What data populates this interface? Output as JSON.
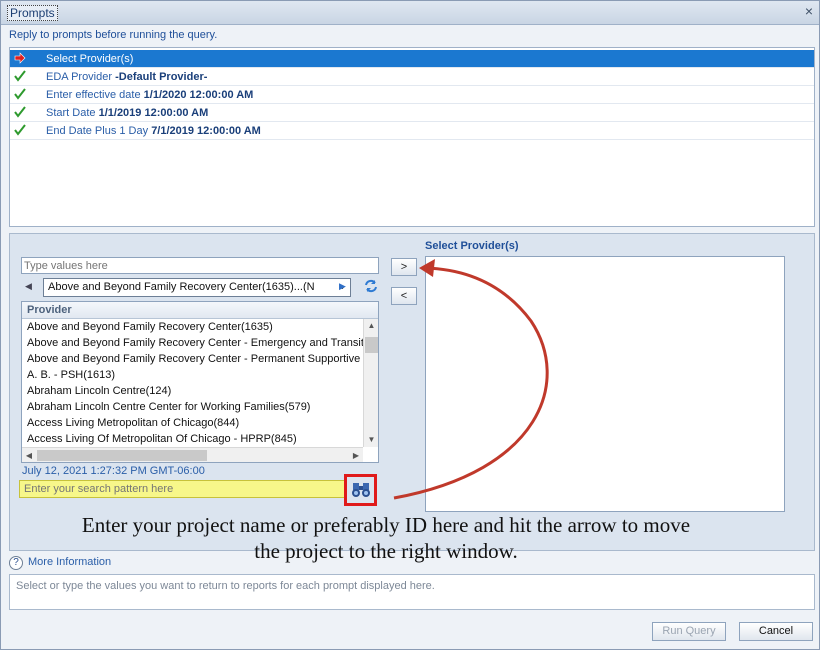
{
  "window": {
    "title": "Prompts",
    "close_glyph": "×"
  },
  "hint": "Reply to prompts before running the query.",
  "prompts": [
    {
      "label": "Select Provider(s)",
      "value": "",
      "status_icon": "red-arrow-icon",
      "selected": true
    },
    {
      "label": "EDA Provider",
      "value": "-Default Provider-",
      "status_icon": "green-check-icon",
      "selected": false
    },
    {
      "label": "Enter effective date",
      "value": "1/1/2020 12:00:00 AM",
      "status_icon": "green-check-icon",
      "selected": false
    },
    {
      "label": "Start Date",
      "value": "1/1/2019 12:00:00 AM",
      "status_icon": "green-check-icon",
      "selected": false
    },
    {
      "label": "End Date Plus 1 Day",
      "value": "7/1/2019 12:00:00 AM",
      "status_icon": "green-check-icon",
      "selected": false
    }
  ],
  "values_input": {
    "placeholder": "Type values here"
  },
  "add_button": ">",
  "remove_button": "<",
  "selected_heading": "Select Provider(s)",
  "provider_dropdown": {
    "selected": "Above and Beyond Family Recovery Center(1635)...(N"
  },
  "provider_list": {
    "header": "Provider",
    "items": [
      "Above and Beyond Family Recovery Center(1635)",
      "Above and Beyond Family Recovery Center - Emergency and Transitional",
      "Above and Beyond Family Recovery Center - Permanent Supportive H",
      "A. B. - PSH(1613)",
      "Abraham Lincoln Centre(124)",
      "Abraham Lincoln Centre Center for Working Families(579)",
      "Access Living Metropolitan of Chicago(844)",
      "Access Living Of Metropolitan Of Chicago - HPRP(845)"
    ]
  },
  "timestamp": "July 12, 2021 1:27:32 PM GMT-06:00",
  "search": {
    "placeholder": "Enter your search pattern here"
  },
  "annotation": {
    "line1": "Enter your project name or preferably ID here and hit the arrow to move",
    "line2": "the project to the right window."
  },
  "more_info": "More Information",
  "description": "Select or type the values you want to return to reports for each prompt displayed here.",
  "footer": {
    "run_query": "Run Query",
    "cancel": "Cancel"
  },
  "colors": {
    "selection_blue": "#1b78d0",
    "highlight_yellow": "#f7f78a",
    "annotation_red": "#c0392b",
    "box_red": "#e01a1a"
  }
}
